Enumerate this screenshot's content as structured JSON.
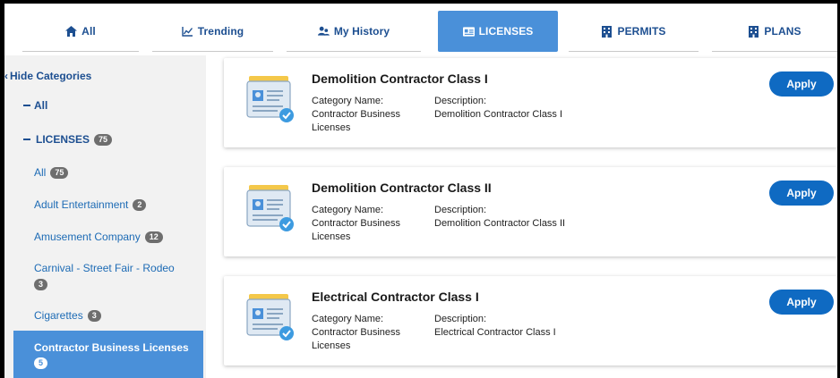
{
  "tabs": [
    {
      "label": "All",
      "icon": "home-icon"
    },
    {
      "label": "Trending",
      "icon": "line-chart-icon"
    },
    {
      "label": "My History",
      "icon": "users-icon"
    },
    {
      "label": "LICENSES",
      "icon": "id-card-icon"
    },
    {
      "label": "PERMITS",
      "icon": "building-icon"
    },
    {
      "label": "PLANS",
      "icon": "building-icon"
    }
  ],
  "sidebar": {
    "hide_label": "Hide Categories",
    "all_root": "All",
    "licenses_label": "LICENSES",
    "licenses_count": "75",
    "items": [
      {
        "label": "All",
        "count": "75"
      },
      {
        "label": "Adult Entertainment",
        "count": "2"
      },
      {
        "label": "Amusement Company",
        "count": "12"
      },
      {
        "label": "Carnival - Street Fair - Rodeo",
        "count": "3"
      },
      {
        "label": "Cigarettes",
        "count": "3"
      },
      {
        "label": "Contractor Business Licenses",
        "count": "5"
      }
    ]
  },
  "cards": [
    {
      "title": "Demolition Contractor Class I",
      "cat_label": "Category Name:",
      "cat_value1": "Contractor Business",
      "cat_value2": "Licenses",
      "desc_label": "Description:",
      "desc_value": "Demolition Contractor Class I",
      "apply": "Apply"
    },
    {
      "title": "Demolition Contractor Class II",
      "cat_label": "Category Name:",
      "cat_value1": "Contractor Business",
      "cat_value2": "Licenses",
      "desc_label": "Description:",
      "desc_value": "Demolition Contractor Class II",
      "apply": "Apply"
    },
    {
      "title": "Electrical Contractor Class I",
      "cat_label": "Category Name:",
      "cat_value1": "Contractor Business",
      "cat_value2": "Licenses",
      "desc_label": "Description:",
      "desc_value": "Electrical Contractor Class I",
      "apply": "Apply"
    }
  ],
  "colors": {
    "accent": "#4a90d9",
    "link": "#1d4f91",
    "apply": "#0f6ac2",
    "badge": "#6e6e6e"
  }
}
